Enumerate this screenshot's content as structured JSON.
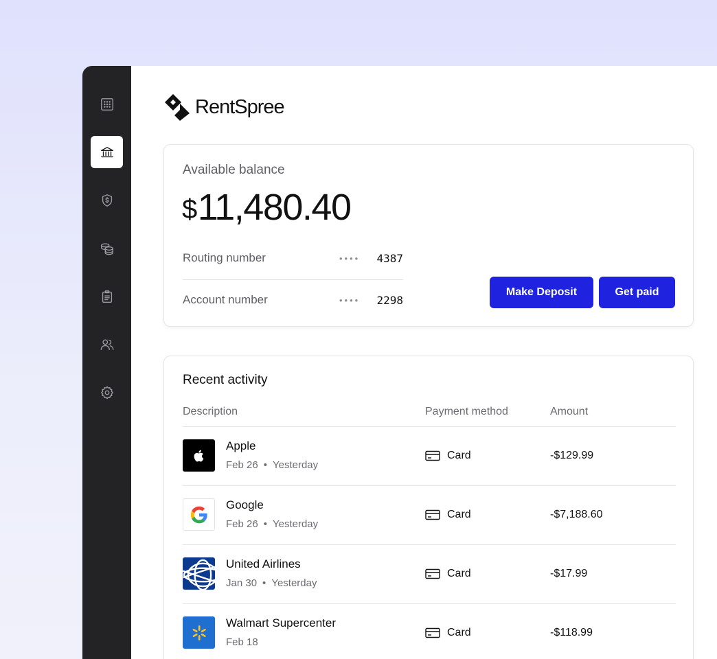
{
  "brand": {
    "name": "RentSpree"
  },
  "sidebar": {
    "items": [
      {
        "icon": "grid-icon",
        "active": false
      },
      {
        "icon": "bank-icon",
        "active": true
      },
      {
        "icon": "shield-dollar-icon",
        "active": false
      },
      {
        "icon": "coins-icon",
        "active": false
      },
      {
        "icon": "clipboard-icon",
        "active": false
      },
      {
        "icon": "users-icon",
        "active": false
      },
      {
        "icon": "gear-icon",
        "active": false
      }
    ]
  },
  "balance": {
    "label": "Available balance",
    "currency": "$",
    "amount": "11,480.40",
    "routing_label": "Routing number",
    "routing_mask": "••••",
    "routing_last4": "4387",
    "account_label": "Account number",
    "account_mask": "••••",
    "account_last4": "2298",
    "deposit_label": "Make Deposit",
    "getpaid_label": "Get paid"
  },
  "activity": {
    "title": "Recent activity",
    "columns": {
      "description": "Description",
      "method": "Payment method",
      "amount": "Amount"
    },
    "transactions": [
      {
        "logo": "apple-logo",
        "name": "Apple",
        "date": "Feb 26",
        "sep": "•",
        "relative": "Yesterday",
        "method": "Card",
        "amount": "-$129.99"
      },
      {
        "logo": "google-logo",
        "name": "Google",
        "date": "Feb 26",
        "sep": "•",
        "relative": "Yesterday",
        "method": "Card",
        "amount": "-$7,188.60"
      },
      {
        "logo": "united-airlines-logo",
        "name": "United Airlines",
        "date": "Jan 30",
        "sep": "•",
        "relative": "Yesterday",
        "method": "Card",
        "amount": "-$17.99"
      },
      {
        "logo": "walmart-logo",
        "name": "Walmart Supercenter",
        "date": "Feb 18",
        "sep": "",
        "relative": "",
        "method": "Card",
        "amount": "-$118.99"
      }
    ]
  },
  "colors": {
    "accent": "#1f23e0",
    "sidebar": "#232225",
    "background": "#e0e1fd"
  }
}
